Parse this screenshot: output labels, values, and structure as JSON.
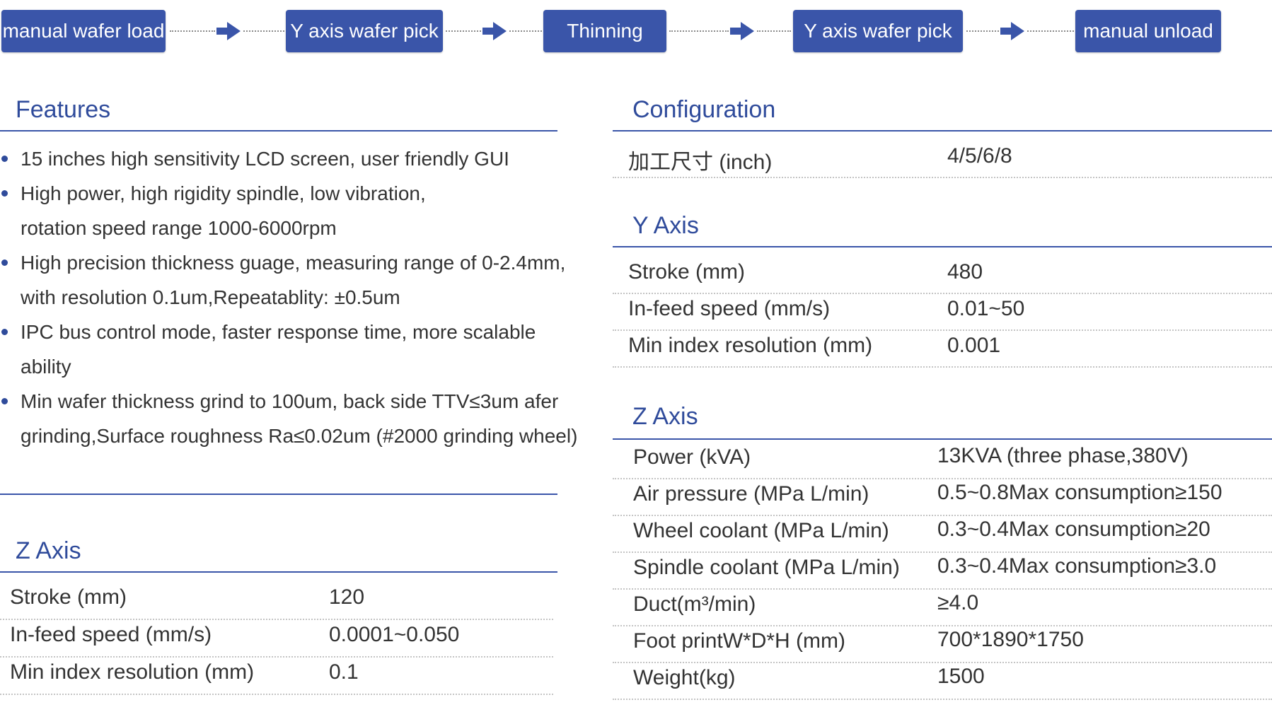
{
  "process_flow": {
    "steps": [
      "manual wafer load",
      "Y axis wafer pick",
      "Thinning",
      "Y axis wafer pick",
      "manual unload"
    ],
    "arrow_icon": "right-arrow-icon"
  },
  "colors": {
    "accent": "#3a55a9",
    "heading": "#2f4b9b",
    "text": "#333333",
    "dotted_rule": "#c4c4c4"
  },
  "features": {
    "title": "Features",
    "items": [
      "15 inches high sensitivity LCD screen, user friendly GUI",
      "High power, high rigidity spindle, low vibration, rotation speed range 1000-6000rpm",
      "High precision thickness guage, measuring range of 0-2.4mm, with resolution 0.1um,Repeatablity: ±0.5um",
      "IPC bus control mode, faster response time, more scalable ability",
      "Min wafer thickness grind to 100um, back side TTV≤3um afer grinding,Surface roughness Ra≤0.02um (#2000 grinding wheel)"
    ]
  },
  "left_z_axis": {
    "title": "Z Axis",
    "rows": [
      {
        "label": "Stroke (mm)",
        "value": "120"
      },
      {
        "label": "In-feed speed (mm/s)",
        "value": "0.0001~0.050"
      },
      {
        "label": "Min index resolution (mm)",
        "value": "0.1"
      }
    ]
  },
  "configuration": {
    "title": "Configuration",
    "rows": [
      {
        "label": "加工尺寸 (inch)",
        "value": "4/5/6/8"
      }
    ]
  },
  "y_axis": {
    "title": "Y Axis",
    "rows": [
      {
        "label": "Stroke (mm)",
        "value": "480"
      },
      {
        "label": "In-feed speed (mm/s)",
        "value": "0.01~50"
      },
      {
        "label": "Min index resolution (mm)",
        "value": "0.001"
      }
    ]
  },
  "right_z_axis": {
    "title": "Z Axis",
    "rows": [
      {
        "label": "Power (kVA)",
        "value": "13KVA (three phase,380V)"
      },
      {
        "label": "Air pressure (MPa  L/min)",
        "value": "0.5~0.8Max consumption≥150"
      },
      {
        "label": "Wheel coolant (MPa   L/min)",
        "value": "0.3~0.4Max consumption≥20"
      },
      {
        "label": "Spindle coolant (MPa   L/min)",
        "value": "0.3~0.4Max consumption≥3.0"
      },
      {
        "label": "Duct(m³/min)",
        "value": "≥4.0"
      },
      {
        "label": "Foot printW*D*H (mm)",
        "value": "700*1890*1750"
      },
      {
        "label": "Weight(kg)",
        "value": "1500"
      }
    ]
  }
}
